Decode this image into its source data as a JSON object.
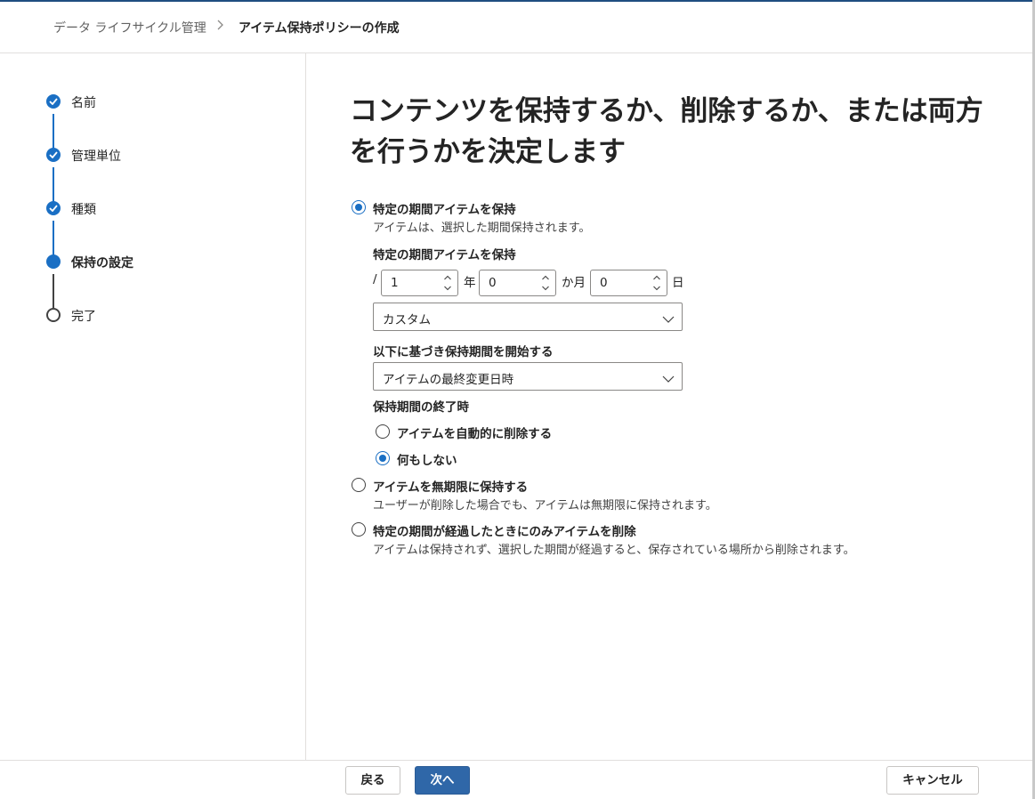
{
  "breadcrumb": {
    "parent": "データ ライフサイクル管理",
    "separator": ">",
    "current": "アイテム保持ポリシーの作成"
  },
  "steps": [
    {
      "label": "名前",
      "state": "done"
    },
    {
      "label": "管理単位",
      "state": "done"
    },
    {
      "label": "種類",
      "state": "done"
    },
    {
      "label": "保持の設定",
      "state": "current"
    },
    {
      "label": "完了",
      "state": "todo"
    }
  ],
  "main": {
    "title": "コンテンツを保持するか、削除するか、または両方を行うかを決定します",
    "option_retain": {
      "label": "特定の期間アイテムを保持",
      "description": "アイテムは、選択した期間保持されます。",
      "checked": true
    },
    "period": {
      "label": "特定の期間アイテムを保持",
      "prefix": "/",
      "years_value": "1",
      "years_unit": "年",
      "months_value": "0",
      "months_unit": "か月",
      "days_value": "0",
      "days_unit": "日",
      "preset": "カスタム"
    },
    "start_based_on": {
      "label": "以下に基づき保持期間を開始する",
      "value": "アイテムの最終変更日時"
    },
    "end_action": {
      "label": "保持期間の終了時",
      "auto_delete": "アイテムを自動的に削除する",
      "do_nothing": "何もしない",
      "selected": "do_nothing"
    },
    "option_forever": {
      "label": "アイテムを無期限に保持する",
      "description": "ユーザーが削除した場合でも、アイテムは無期限に保持されます。",
      "checked": false
    },
    "option_delete_only": {
      "label": "特定の期間が経過したときにのみアイテムを削除",
      "description": "アイテムは保持されず、選択した期間が経過すると、保存されている場所から削除されます。",
      "checked": false
    }
  },
  "footer": {
    "back": "戻る",
    "next": "次へ",
    "cancel": "キャンセル"
  },
  "colors": {
    "accent": "#1a6fc4",
    "primary_button": "#2f67a8",
    "top_border": "#1f4d80"
  }
}
